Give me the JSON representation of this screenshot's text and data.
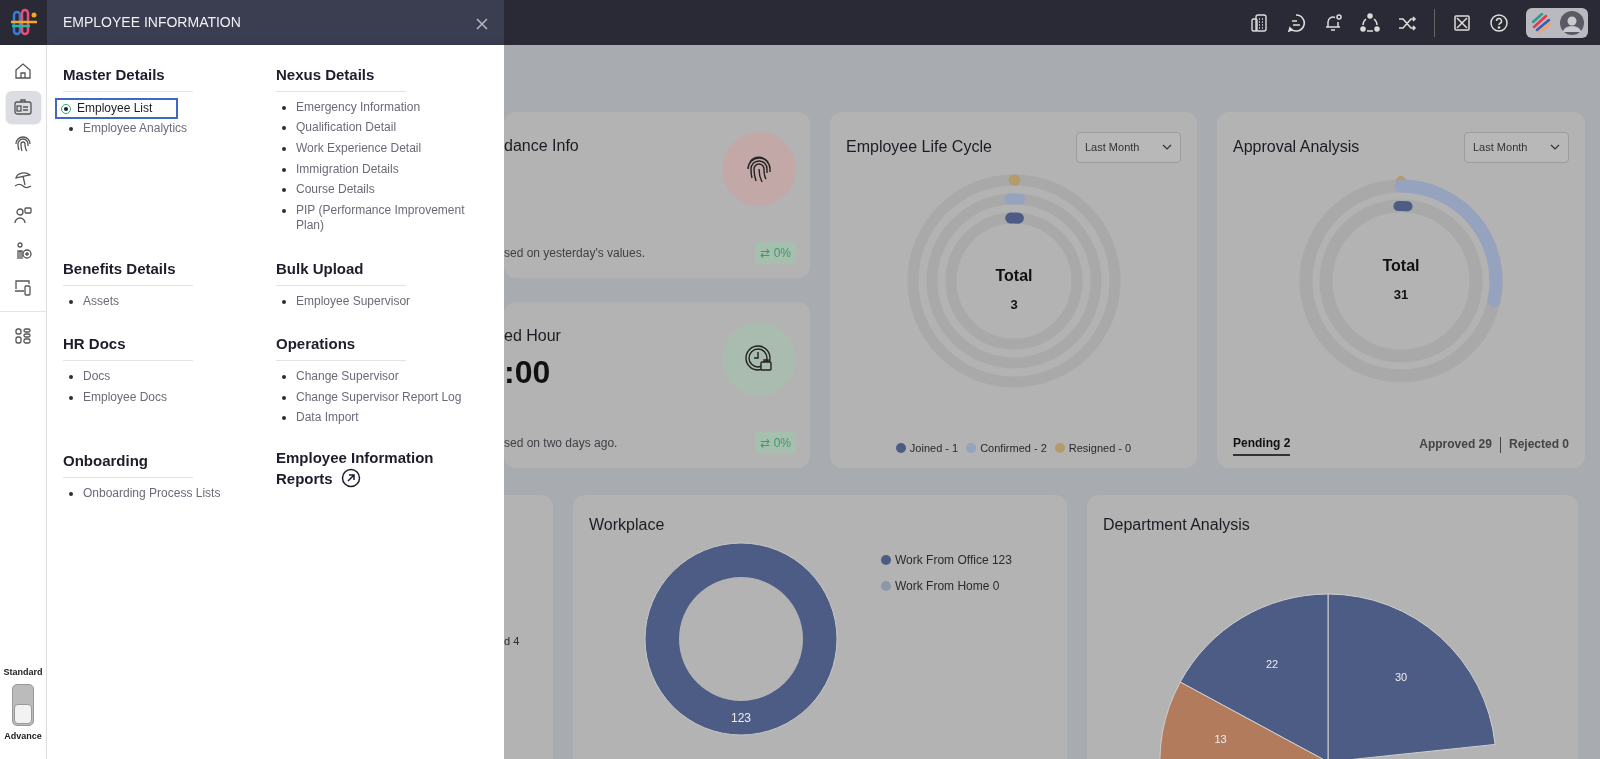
{
  "panel": {
    "title": "EMPLOYEE INFORMATION"
  },
  "rail": {
    "items": [
      {
        "kind": "home",
        "selected": false
      },
      {
        "kind": "id-card",
        "selected": true
      },
      {
        "kind": "fingerprint",
        "selected": false
      },
      {
        "kind": "beach",
        "selected": false
      },
      {
        "kind": "person-chat",
        "selected": false
      },
      {
        "kind": "person-add",
        "selected": false
      },
      {
        "kind": "devices",
        "selected": false
      },
      {
        "kind": "apps",
        "selected": false
      }
    ]
  },
  "mode_toggle": {
    "top_label": "Standard",
    "bottom_label": "Advance",
    "advanced": true
  },
  "sections": [
    {
      "title": "Master Details",
      "items": [
        {
          "label": "Employee List",
          "selected": true
        },
        {
          "label": "Employee Analytics",
          "selected": false
        }
      ]
    },
    {
      "title": "Nexus Details",
      "items": [
        {
          "label": "Emergency Information",
          "selected": false
        },
        {
          "label": "Qualification Detail",
          "selected": false
        },
        {
          "label": "Work Experience Detail",
          "selected": false
        },
        {
          "label": "Immigration Details",
          "selected": false
        },
        {
          "label": "Course Details",
          "selected": false
        },
        {
          "label": "PIP (Performance Improvement Plan)",
          "selected": false
        }
      ]
    },
    {
      "title": "Benefits Details",
      "items": [
        {
          "label": "Assets",
          "selected": false
        }
      ]
    },
    {
      "title": "Bulk Upload",
      "items": [
        {
          "label": "Employee Supervisor",
          "selected": false
        }
      ]
    },
    {
      "title": "HR Docs",
      "items": [
        {
          "label": "Docs",
          "selected": false
        },
        {
          "label": "Employee Docs",
          "selected": false
        }
      ]
    },
    {
      "title": "Operations",
      "items": [
        {
          "label": "Change Supervisor",
          "selected": false
        },
        {
          "label": "Change Supervisor Report Log",
          "selected": false
        },
        {
          "label": "Data Import",
          "selected": false
        }
      ]
    },
    {
      "title": "Onboarding",
      "items": [
        {
          "label": "Onboarding Process Lists",
          "selected": false
        }
      ]
    },
    {
      "title": "Employee Information Reports",
      "kind": "link"
    }
  ],
  "attendance_card": {
    "title": "dance Info",
    "note": "sed on yesterday's values.",
    "change": "⇄ 0%"
  },
  "hour_card": {
    "title": "ed Hour",
    "value": ":00",
    "note": "sed on two days ago.",
    "change": "⇄ 0%"
  },
  "life_cycle": {
    "title": "Employee Life Cycle",
    "filter": "Last Month",
    "center_label": "Total",
    "center_value": "3",
    "legend": [
      {
        "label": "Joined - 1",
        "color": "#4c5c85"
      },
      {
        "label": "Confirmed - 2",
        "color": "#95a3bf"
      },
      {
        "label": "Resigned - 0",
        "color": "#b59a6b"
      }
    ]
  },
  "approval": {
    "title": "Approval Analysis",
    "filter": "Last Month",
    "center_label": "Total",
    "center_value": "31",
    "tabs": [
      {
        "label": "Pending 2",
        "selected": true
      },
      {
        "label": "Approved 29",
        "selected": false
      },
      {
        "label": "Rejected 0",
        "selected": false
      }
    ]
  },
  "side_card": {
    "text": "d 4"
  },
  "workplace": {
    "title": "Workplace",
    "legend": [
      {
        "label": "Work From Office 123",
        "color": "#4c5c85"
      },
      {
        "label": "Work From Home 0",
        "color": "#8e98a8"
      }
    ],
    "chart_data": {
      "type": "donut",
      "values": [
        123,
        0
      ],
      "colors": [
        "#4c5c85",
        "#8e98a8"
      ],
      "data_labels": true
    }
  },
  "department": {
    "title": "Department Analysis",
    "chart_data": {
      "type": "pie",
      "values": [
        30,
        22,
        13
      ],
      "colors": [
        "#4c5c85",
        "#4c5c85",
        "#b27c5c"
      ],
      "data_labels": true
    }
  }
}
